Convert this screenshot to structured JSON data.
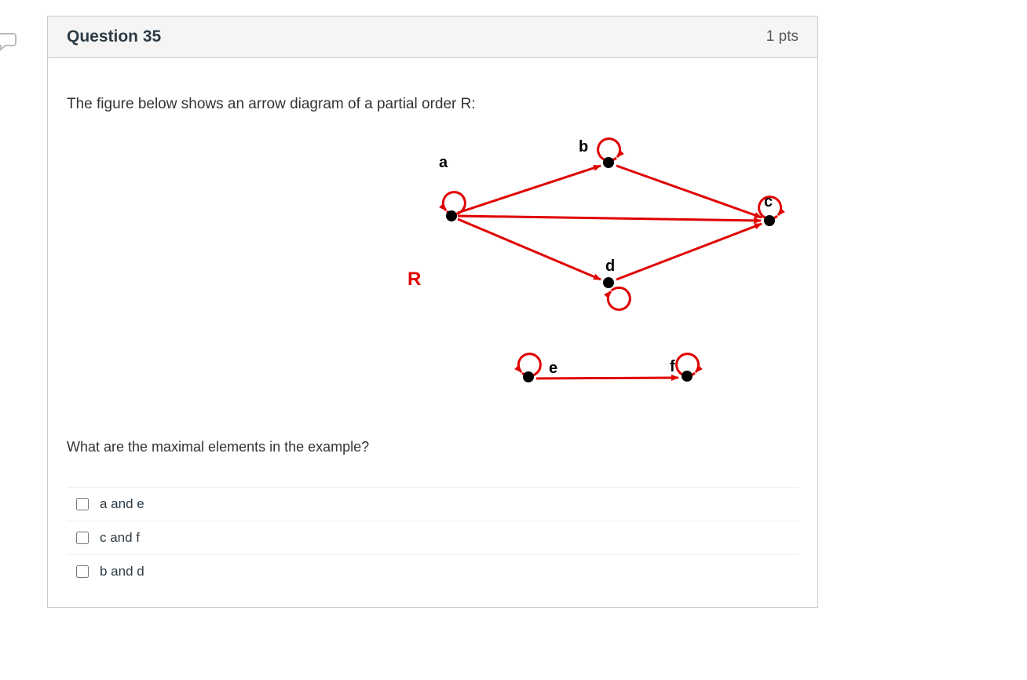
{
  "header": {
    "title": "Question 35",
    "points": "1 pts"
  },
  "prompt": {
    "top": "The figure below shows an arrow diagram of a partial order R:",
    "bottom": "What are the maximal elements in the example?"
  },
  "diagram": {
    "relationLabel": "R",
    "nodes": {
      "a": "a",
      "b": "b",
      "c": "c",
      "d": "d",
      "e": "e",
      "f": "f"
    }
  },
  "answers": [
    {
      "label": "a and e"
    },
    {
      "label": "c and f"
    },
    {
      "label": "b and d"
    }
  ]
}
